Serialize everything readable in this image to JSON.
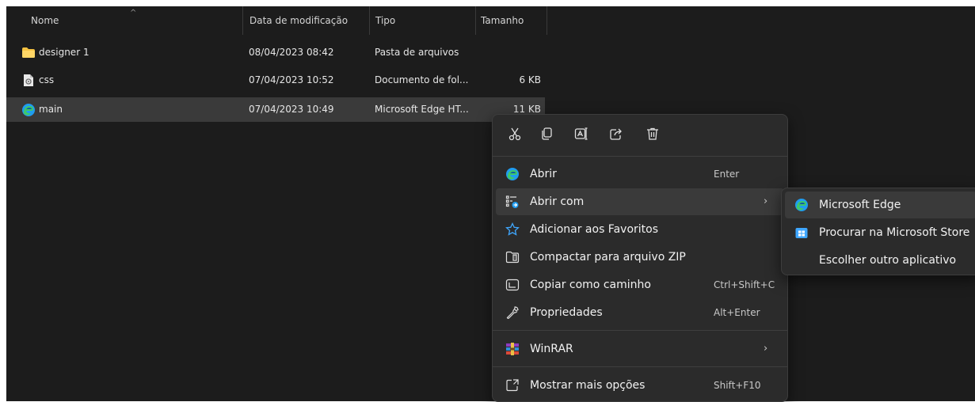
{
  "columns": {
    "name": "Nome",
    "modified": "Data de modificação",
    "type": "Tipo",
    "size": "Tamanho"
  },
  "files": [
    {
      "name": "designer 1",
      "modified": "08/04/2023 08:42",
      "type": "Pasta de arquivos",
      "size": "",
      "icon": "folder-icon"
    },
    {
      "name": "css",
      "modified": "07/04/2023 10:52",
      "type": "Documento de fol...",
      "size": "6 KB",
      "icon": "css-file-icon"
    },
    {
      "name": "main",
      "modified": "07/04/2023 10:49",
      "type": "Microsoft Edge HT...",
      "size": "11 KB",
      "icon": "edge-icon"
    }
  ],
  "context_menu": {
    "toolbar": [
      "cut-icon",
      "copy-icon",
      "rename-icon",
      "share-icon",
      "delete-icon"
    ],
    "items": [
      {
        "label": "Abrir",
        "shortcut": "Enter",
        "icon": "edge-icon"
      },
      {
        "label": "Abrir com",
        "shortcut": "",
        "icon": "open-with-icon",
        "submenu": true
      },
      {
        "label": "Adicionar aos Favoritos",
        "shortcut": "",
        "icon": "star-icon"
      },
      {
        "label": "Compactar para arquivo ZIP",
        "shortcut": "",
        "icon": "zip-icon"
      },
      {
        "label": "Copiar como caminho",
        "shortcut": "Ctrl+Shift+C",
        "icon": "copy-path-icon"
      },
      {
        "label": "Propriedades",
        "shortcut": "Alt+Enter",
        "icon": "wrench-icon"
      },
      {
        "label": "WinRAR",
        "shortcut": "",
        "icon": "winrar-icon",
        "submenu": true
      },
      {
        "label": "Mostrar mais opções",
        "shortcut": "Shift+F10",
        "icon": "more-options-icon"
      }
    ],
    "arrow": "›"
  },
  "submenu": {
    "items": [
      {
        "label": "Microsoft Edge",
        "icon": "edge-icon"
      },
      {
        "label": "Procurar na Microsoft Store",
        "icon": "store-icon"
      },
      {
        "label": "Escolher outro aplicativo",
        "icon": ""
      }
    ]
  },
  "colors": {
    "background": "#1c1c1c",
    "menu": "#2b2b2b",
    "highlight": "#3a3a3a",
    "folder": "#f6c342",
    "edge": "#1f9cf0"
  }
}
